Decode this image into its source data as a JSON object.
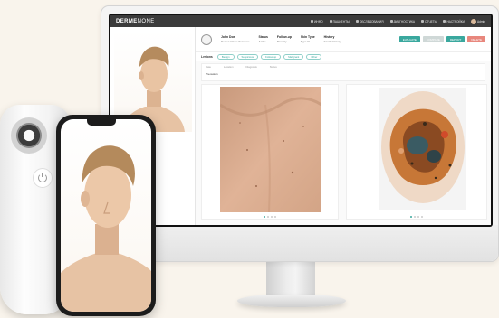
{
  "app": {
    "logo_bold": "DERME",
    "logo_light": "NONE",
    "nav": [
      {
        "icon": "grid-icon",
        "label": "ИНФО"
      },
      {
        "icon": "user-icon",
        "label": "ПАЦИЕНТЫ"
      },
      {
        "icon": "list-icon",
        "label": "ОБСЛЕДОВАНИЯ"
      },
      {
        "icon": "chart-icon",
        "label": "ДИАГНОСТИКА"
      },
      {
        "icon": "doc-icon",
        "label": "ОТЧЕТЫ"
      },
      {
        "icon": "gear-icon",
        "label": "НАСТРОЙКИ"
      },
      {
        "icon": "avatar-icon",
        "label": "Admin"
      }
    ]
  },
  "patient": {
    "name_key": "John Doe",
    "name_val": "Doctor: Name Surname",
    "col2_key": "Status",
    "col2_val": "Active",
    "col3_key": "Follow-up",
    "col3_val": "Monthly",
    "col4_key": "Skin Type",
    "col4_val": "Type III",
    "col5_key": "History",
    "col5_val": "Family history",
    "buttons": [
      {
        "label": "EVALUATE",
        "color": "#3aa89e"
      },
      {
        "label": "COMPARE",
        "color": "#cfd8d7"
      },
      {
        "label": "REPORT",
        "color": "#3aa89e"
      },
      {
        "label": "DELETE",
        "color": "#e8877d"
      }
    ]
  },
  "filters": {
    "label": "Lesions",
    "chips": [
      "Benign",
      "Suspicious",
      "Follow-up",
      "Malignant",
      "Other"
    ]
  },
  "table": {
    "headers": [
      "Date",
      "Location",
      "Diagnosis",
      "Status"
    ],
    "row": "Pre-lesion"
  },
  "left_panel": {
    "add_label": "+ ADD"
  },
  "colors": {
    "accent": "#3aa89e",
    "danger": "#e8877d",
    "appbar": "#3b3b3b"
  }
}
